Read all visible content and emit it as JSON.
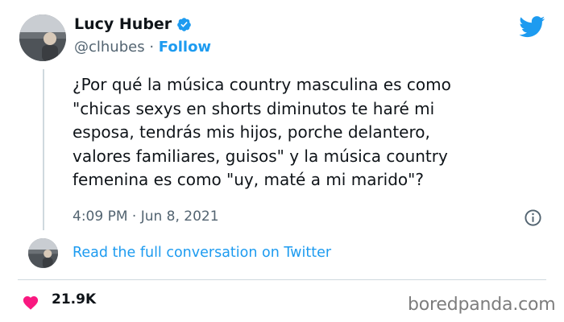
{
  "tweet": {
    "author": {
      "name": "Lucy Huber",
      "handle": "@clhubes",
      "separator": "·",
      "follow_label": "Follow"
    },
    "text": "¿Por qué la música country masculina es como\n\"chicas sexys en shorts diminutos te haré mi\nesposa, tendrás mis hijos, porche delantero,\nvalores familiares, guisos\" y la música country\nfemenina es como \"uy, maté a mi marido\"?",
    "timestamp": "4:09 PM · Jun 8, 2021",
    "read_conversation_label": "Read the full conversation on Twitter",
    "likes": "21.9K"
  },
  "watermark": "boredpanda.com",
  "colors": {
    "link": "#1d9bf0",
    "like": "#f91880",
    "muted": "#536471",
    "verified": "#1d9bf0"
  },
  "icons": [
    "verified-badge-icon",
    "twitter-bird-icon",
    "info-icon",
    "heart-icon"
  ]
}
